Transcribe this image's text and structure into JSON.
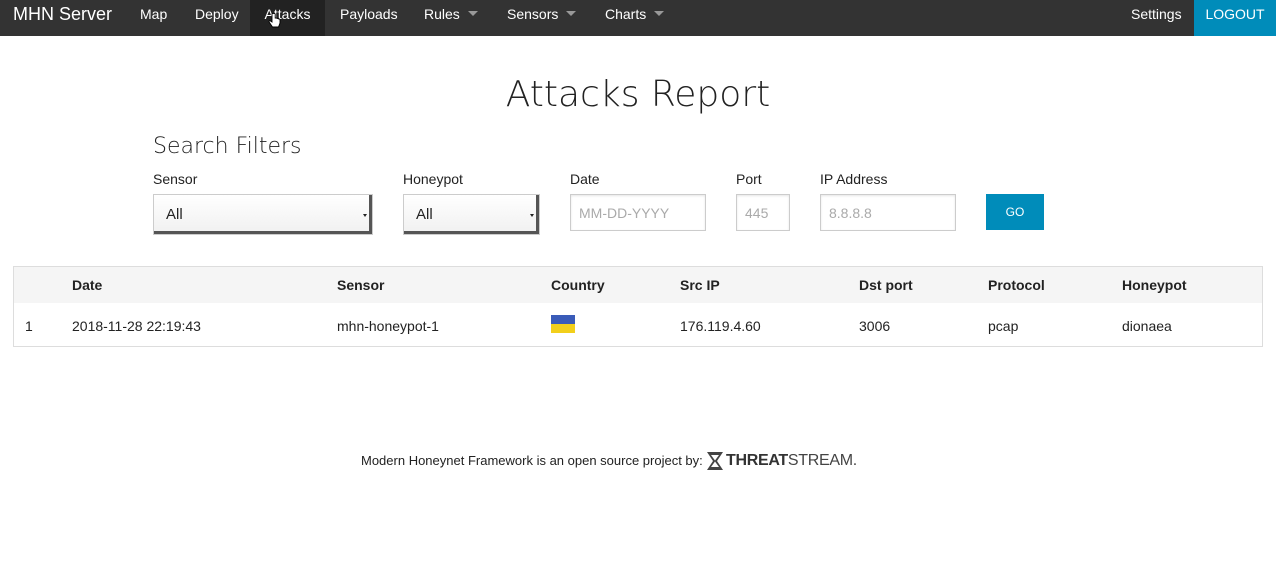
{
  "navbar": {
    "brand": "MHN Server",
    "items": [
      {
        "label": "Map"
      },
      {
        "label": "Deploy"
      },
      {
        "label": "Attacks"
      },
      {
        "label": "Payloads"
      },
      {
        "label": "Rules"
      },
      {
        "label": "Sensors"
      },
      {
        "label": "Charts"
      }
    ],
    "settings": "Settings",
    "logout": "LOGOUT",
    "accent_color": "#008cba",
    "background_color": "#333333"
  },
  "page": {
    "title": "Attacks Report"
  },
  "filters": {
    "title": "Search Filters",
    "sensor": {
      "label": "Sensor",
      "value": "All"
    },
    "honeypot": {
      "label": "Honeypot",
      "value": "All"
    },
    "date": {
      "label": "Date",
      "placeholder": "MM-DD-YYYY"
    },
    "port": {
      "label": "Port",
      "placeholder": "445"
    },
    "ip": {
      "label": "IP Address",
      "placeholder": "8.8.8.8"
    },
    "go_label": "GO"
  },
  "table": {
    "columns": [
      "",
      "Date",
      "Sensor",
      "Country",
      "Src IP",
      "Dst port",
      "Protocol",
      "Honeypot"
    ],
    "rows": [
      {
        "index": "1",
        "date": "2018-11-28 22:19:43",
        "sensor": "mhn-honeypot-1",
        "country_flag": "ukraine-flag-icon",
        "src_ip": "176.119.4.60",
        "dst_port": "3006",
        "protocol": "pcap",
        "honeypot": "dionaea"
      }
    ]
  },
  "footer": {
    "text": "Modern Honeynet Framework is an open source project by:",
    "logo_bold": "THREAT",
    "logo_light": "STREAM."
  }
}
